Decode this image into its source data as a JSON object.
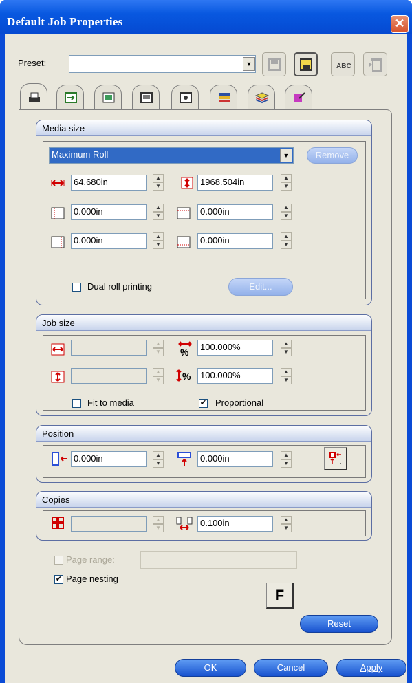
{
  "window": {
    "title": "Default Job Properties",
    "close": "✕"
  },
  "preset": {
    "label": "Preset:",
    "value": ""
  },
  "tabs": [
    "general-tab",
    "layout-tab",
    "color-tab",
    "print-tab",
    "marks-tab",
    "stripes-tab",
    "layers-tab",
    "color-edit-tab"
  ],
  "media_size": {
    "title": "Media size",
    "dropdown": "Maximum Roll",
    "remove": "Remove",
    "width": "64.680in",
    "height": "1968.504in",
    "margin_left": "0.000in",
    "margin_top": "0.000in",
    "margin_right": "0.000in",
    "margin_bottom": "0.000in",
    "dual_roll_label": "Dual roll printing",
    "edit": "Edit..."
  },
  "job_size": {
    "title": "Job size",
    "width": "",
    "height": "",
    "scale_x": "100.000%",
    "scale_y": "100.000%",
    "fit_label": "Fit to media",
    "proportional_label": "Proportional",
    "proportional_check": "✔"
  },
  "position": {
    "title": "Position",
    "x": "0.000in",
    "y": "0.000in"
  },
  "copies": {
    "title": "Copies",
    "count": "",
    "spacing": "0.100in"
  },
  "page_range": {
    "label": "Page range:",
    "value": ""
  },
  "page_nesting": {
    "label": "Page nesting",
    "check": "✔"
  },
  "f_button": "F",
  "buttons": {
    "reset": "Reset",
    "ok": "OK",
    "cancel": "Cancel",
    "apply": "Apply"
  },
  "colors": {
    "accent": "#1852cf",
    "titlebar": "#0858e0",
    "panel": "#e9e7dc",
    "red_icon": "#d00000"
  }
}
